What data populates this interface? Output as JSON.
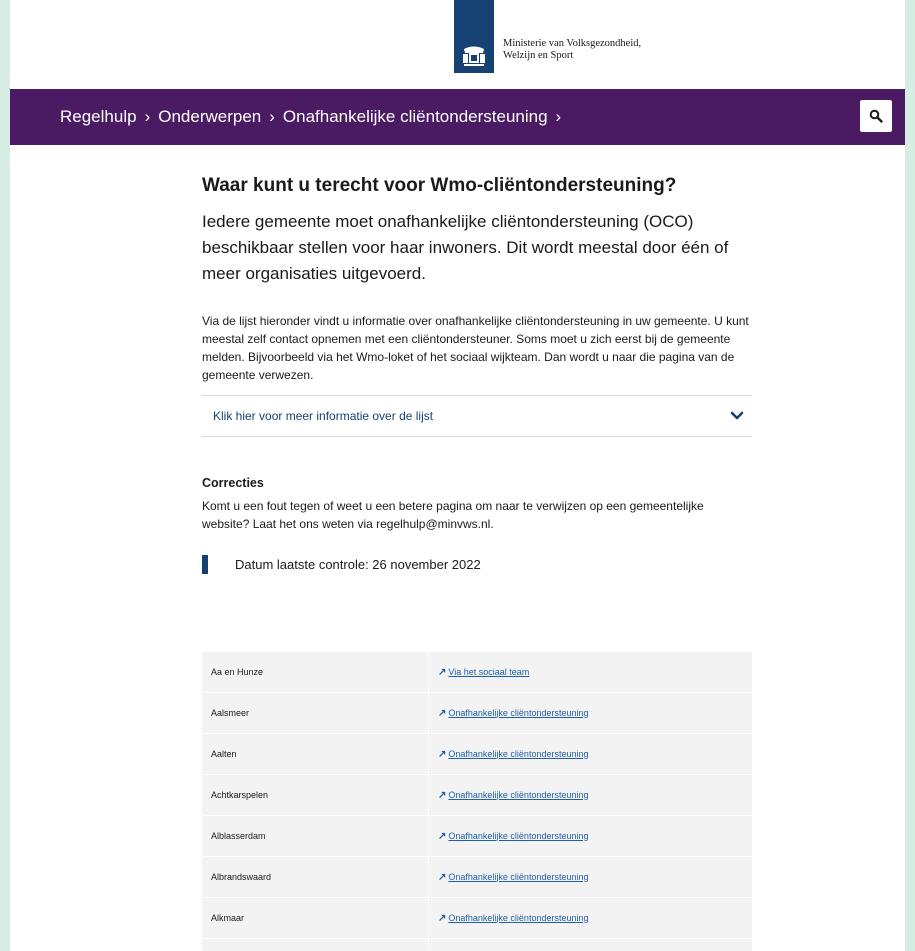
{
  "header": {
    "ministry_line1": "Ministerie van Volksgezondheid,",
    "ministry_line2": "Welzijn en Sport"
  },
  "nav": {
    "crumbs": [
      "Regelhulp",
      "Onderwerpen",
      "Onafhankelijke cliëntondersteuning"
    ],
    "separator": "›"
  },
  "main": {
    "title": "Waar kunt u terecht voor Wmo-cliëntondersteuning?",
    "lead": "Iedere gemeente moet onafhankelijke cliëntondersteuning (OCO) beschikbaar stellen voor haar inwoners. Dit wordt meestal door één of meer organisaties uitgevoerd.",
    "intro": "Via de lijst hieronder vindt u informatie over onafhankelijke cliëntondersteuning in uw gemeente. U kunt meestal zelf contact opnemen met een cliëntondersteuner. Soms moet u zich eerst bij de gemeente melden. Bijvoorbeeld via het Wmo-loket of het sociaal wijkteam. Dan wordt u naar die pagina van de gemeente verwezen.",
    "accordion_label": "Klik hier voor meer informatie over de lijst",
    "corrections_title": "Correcties",
    "corrections_text": "Komt u een fout tegen of weet u een betere pagina om naar te verwijzen op een gemeentelijke website? Laat het ons weten via regelhulp@minvws.nl.",
    "date_text": "Datum laatste controle: 26 november 2022"
  },
  "table": {
    "rows": [
      {
        "gemeente": "Aa en Hunze",
        "link": "Via het sociaal team"
      },
      {
        "gemeente": "Aalsmeer",
        "link": "Onafhankelijke cliëntondersteuning"
      },
      {
        "gemeente": "Aalten",
        "link": "Onafhankelijke cliëntondersteuning"
      },
      {
        "gemeente": "Achtkarspelen",
        "link": "Onafhankelijke cliëntondersteuning"
      },
      {
        "gemeente": "Alblasserdam",
        "link": "Onafhankelijke cliëntondersteuning"
      },
      {
        "gemeente": "Albrandswaard",
        "link": "Onafhankelijke cliëntondersteuning"
      },
      {
        "gemeente": "Alkmaar",
        "link": "Onafhankelijke cliëntondersteuning"
      },
      {
        "gemeente": "",
        "link": ""
      }
    ]
  },
  "colors": {
    "nav_bg": "#4a1b63",
    "logo_blue": "#154273",
    "link": "#1f5fa8",
    "outer_bg": "#d6ede4"
  },
  "icons": {
    "search": "search-icon",
    "chevron": "chevron-down-icon",
    "external": "external-link-icon"
  }
}
